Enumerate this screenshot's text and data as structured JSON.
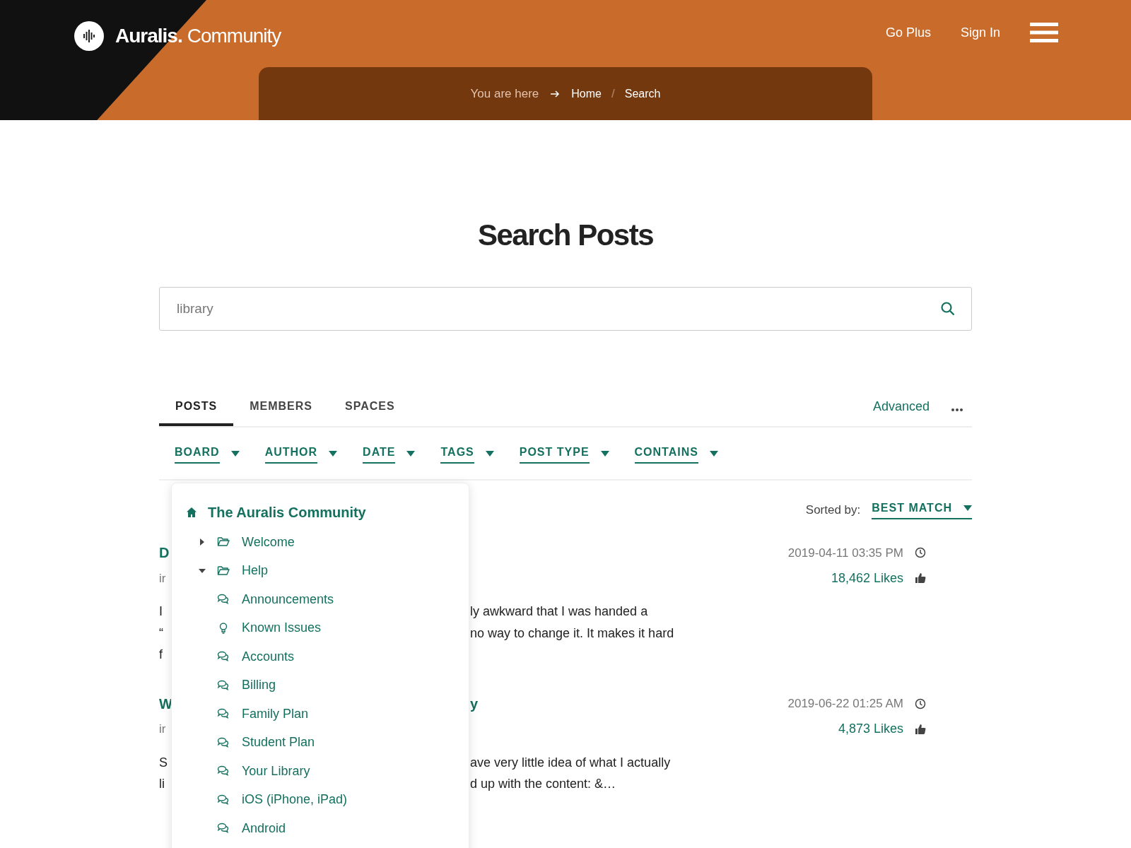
{
  "header": {
    "logo_bold": "Auralis.",
    "logo_light": "Community",
    "nav": [
      "Go Plus",
      "Sign In"
    ]
  },
  "breadcrumb": {
    "label": "You are here",
    "items": [
      "Home",
      "Search"
    ],
    "separator": "/"
  },
  "title": "Search Posts",
  "search": {
    "value": "library"
  },
  "tabs": [
    {
      "label": "POSTS",
      "selected": true
    },
    {
      "label": "MEMBERS",
      "selected": false
    },
    {
      "label": "SPACES",
      "selected": false
    }
  ],
  "advanced": "Advanced",
  "filters": [
    "BOARD",
    "AUTHOR",
    "DATE",
    "TAGS",
    "POST TYPE",
    "CONTAINS"
  ],
  "board_menu": {
    "root": "The Auralis Community",
    "items": [
      {
        "label": "Welcome",
        "kind": "folder",
        "expanded": false
      },
      {
        "label": "Help",
        "kind": "folder",
        "expanded": true,
        "children": [
          {
            "label": "Announcements",
            "kind": "board"
          },
          {
            "label": "Known Issues",
            "kind": "idea"
          },
          {
            "label": "Accounts",
            "kind": "board"
          },
          {
            "label": "Billing",
            "kind": "board"
          },
          {
            "label": "Family Plan",
            "kind": "board"
          },
          {
            "label": "Student Plan",
            "kind": "board"
          },
          {
            "label": "Your Library",
            "kind": "board"
          },
          {
            "label": "iOS (iPhone, iPad)",
            "kind": "board"
          },
          {
            "label": "Android",
            "kind": "board"
          }
        ]
      }
    ]
  },
  "sort": {
    "label": "Sorted by:",
    "value": "BEST MATCH"
  },
  "results": [
    {
      "title": {
        "left": "D"
      },
      "meta": {
        "left": "ir"
      },
      "date": "2019-04-11 03:35 PM",
      "likes": "18,462 Likes",
      "lines": [
        {
          "left": "I",
          "right": "ly awkward that I was handed a"
        },
        {
          "left": "“",
          "right": "no way to change it. It makes it hard"
        },
        {
          "left": "f"
        }
      ]
    },
    {
      "title": {
        "left": "W",
        "right": "y"
      },
      "meta": {
        "left": "ir"
      },
      "date": "2019-06-22 01:25 AM",
      "likes": "4,873 Likes",
      "lines": [
        {
          "left": "S",
          "right": "ave very little idea of what I actually"
        },
        {
          "left": "li",
          "right": "d up with the content: &…"
        }
      ]
    }
  ]
}
